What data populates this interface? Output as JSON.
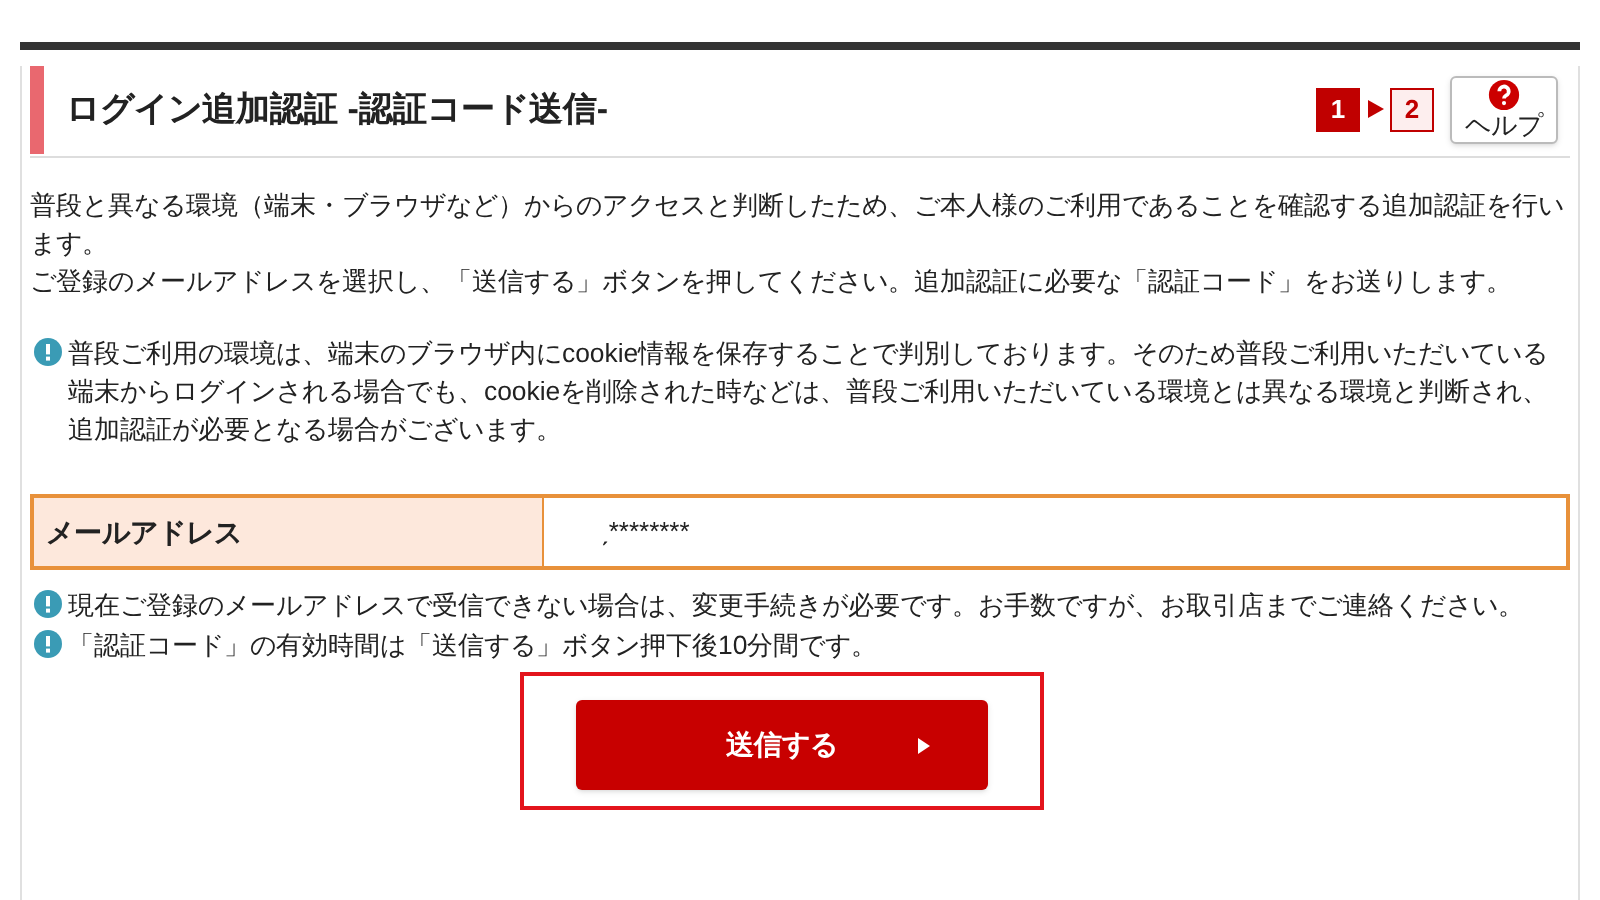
{
  "header": {
    "title": "ログイン追加認証 -認証コード送信-",
    "steps": [
      {
        "label": "1",
        "selected": true
      },
      {
        "label": "2",
        "selected": false
      }
    ],
    "help_button": {
      "label": "ヘルプ"
    }
  },
  "intro": [
    "普段と異なる環境（端末・ブラウザなど）からのアクセスと判断したため、ご本人様のご利用であることを確認する追加認証を行います。",
    "ご登録のメールアドレスを選択し、「送信する」ボタンを押してください。追加認証に必要な「認証コード」をお送りします。"
  ],
  "info_note": "普段ご利用の環境は、端末のブラウザ内にcookie情報を保存することで判別しております。そのため普段ご利用いただいている端末からログインされる場合でも、cookieを削除された時などは、普段ご利用いただいている環境とは異なる環境と判断され、追加認証が必要となる場合がございます。",
  "field": {
    "label": "メールアドレス",
    "value": "ˏ********"
  },
  "field_notes": [
    "現在ご登録のメールアドレスで受信できない場合は、変更手続きが必要です。お手数ですが、お取引店までご連絡ください。",
    "「認証コード」の有効時間は「送信する」ボタン押下後10分間です。"
  ],
  "submit_button": {
    "label": "送信する",
    "highlighted": true
  }
}
